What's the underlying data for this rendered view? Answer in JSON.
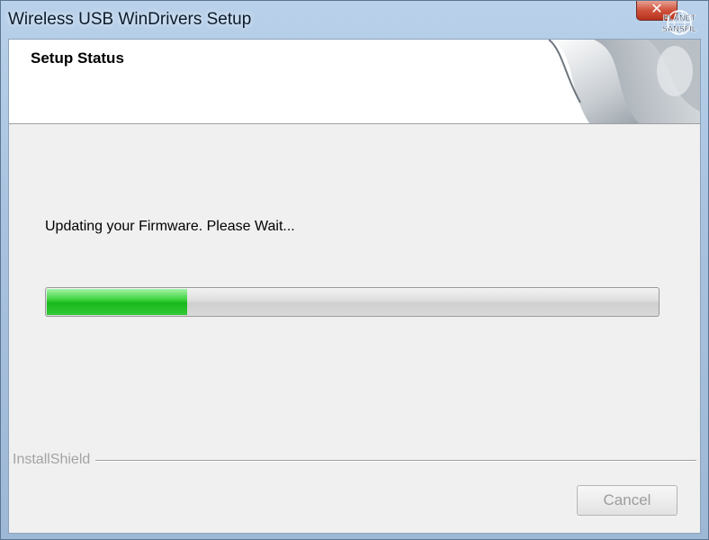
{
  "window": {
    "title": "Wireless USB WinDrivers Setup",
    "close_glyph": "✕",
    "close_color": "#c8432c"
  },
  "watermark": {
    "line1": "PLANET",
    "line2": "SANSFIL"
  },
  "header": {
    "title": "Setup Status"
  },
  "body": {
    "status_text": "Updating your Firmware. Please Wait...",
    "progress_percent": 23,
    "progress_color": "#2cc530"
  },
  "footer": {
    "brand": "InstallShield",
    "cancel_label": "Cancel",
    "cancel_enabled": false
  }
}
